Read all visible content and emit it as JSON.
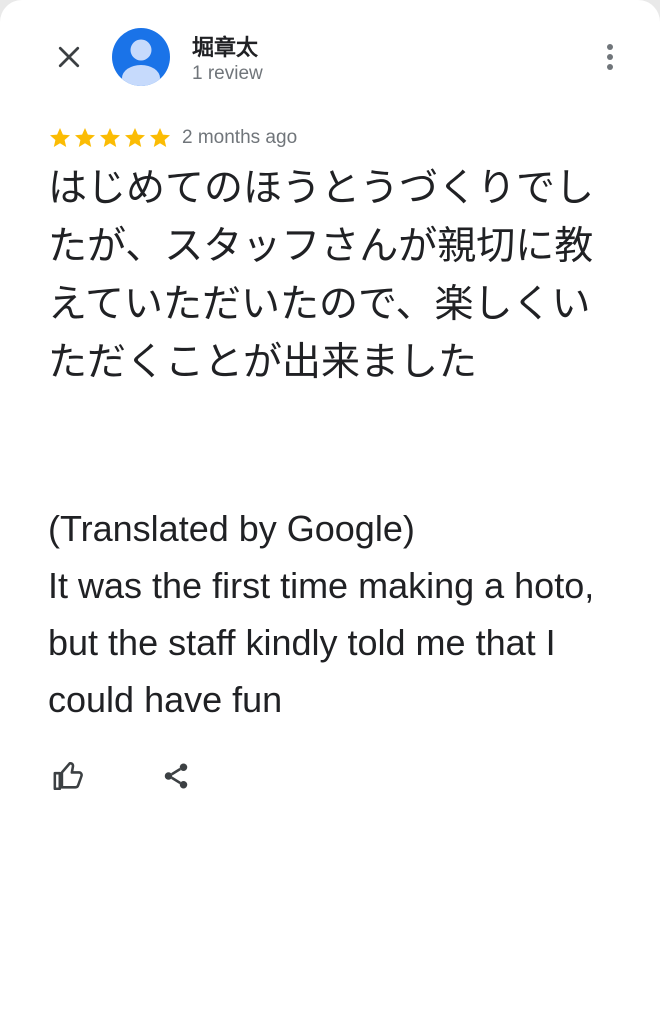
{
  "reviewer": {
    "name": "堀章太",
    "review_count": "1 review",
    "avatar_icon": "person-avatar-icon",
    "avatar_color": "#1a73e8"
  },
  "header": {
    "close_icon": "close-icon",
    "more_icon": "more-vert-icon"
  },
  "rating": {
    "stars": 5,
    "max_stars": 5,
    "star_color": "#fbbc04",
    "date": "2 months ago"
  },
  "review": {
    "original": "はじめてのほうとうづくりでしたが、スタッフさんが親切に教えていただいたので、楽しくいただくことが出来ました",
    "translation_label": "(Translated by Google)",
    "translation": "It was the first time making a hoto, but the staff kindly told me that I could have fun"
  },
  "actions": {
    "like_icon": "thumb-up-icon",
    "share_icon": "share-icon"
  }
}
